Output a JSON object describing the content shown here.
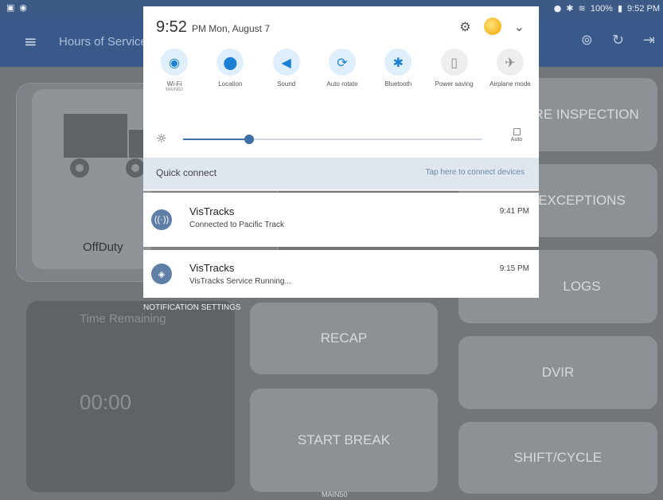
{
  "statusbar": {
    "left_icons": [
      "gallery-icon",
      "wifi-icon"
    ],
    "right_text": "100%",
    "time": "9:52 PM"
  },
  "appbar": {
    "title": "Hours of Service"
  },
  "background": {
    "status_label": "OffDuty",
    "time_remaining_label": "Time Remaining",
    "time_remaining_value": "00:00",
    "tiles": {
      "inspection": "PRE INSPECTION",
      "exceptions": "EXCEPTIONS",
      "logs": "LOGS",
      "recap": "RECAP",
      "dvir": "DVIR",
      "start_break": "START BREAK",
      "shift_cycle": "SHIFT/CYCLE"
    },
    "footer_label": "MAIN50"
  },
  "shade": {
    "time": "9:52",
    "ampm_date": "PM Mon, August 7",
    "toggles": [
      {
        "name": "wifi",
        "label": "Wi-Fi",
        "sub": "MAIN50",
        "state": "on",
        "icon": "wifi-icon"
      },
      {
        "name": "location",
        "label": "Location",
        "sub": "",
        "state": "on",
        "icon": "location-icon"
      },
      {
        "name": "sound",
        "label": "Sound",
        "sub": "",
        "state": "on",
        "icon": "sound-icon"
      },
      {
        "name": "auto-rotate",
        "label": "Auto rotate",
        "sub": "",
        "state": "on",
        "icon": "rotate-icon"
      },
      {
        "name": "bluetooth",
        "label": "Bluetooth",
        "sub": "",
        "state": "on",
        "icon": "bluetooth-icon"
      },
      {
        "name": "power-saving",
        "label": "Power saving",
        "sub": "",
        "state": "off",
        "icon": "battery-icon"
      },
      {
        "name": "airplane",
        "label": "Airplane mode",
        "sub": "",
        "state": "off",
        "icon": "airplane-icon"
      }
    ],
    "brightness_level": 0.22,
    "auto_label": "Auto",
    "quick_connect_label": "Quick connect",
    "quick_connect_hint": "Tap here to connect devices"
  },
  "notifications": [
    {
      "app": "VisTracks",
      "message": "Connected to Pacific Track",
      "time": "9:41 PM"
    },
    {
      "app": "VisTracks",
      "message": "VisTracks Service Running...",
      "time": "9:15 PM"
    }
  ],
  "notification_settings_label": "NOTIFICATION SETTINGS",
  "colors": {
    "appbar": "#39598a",
    "accent": "#1c7fd4",
    "dim_background": "#717679"
  }
}
